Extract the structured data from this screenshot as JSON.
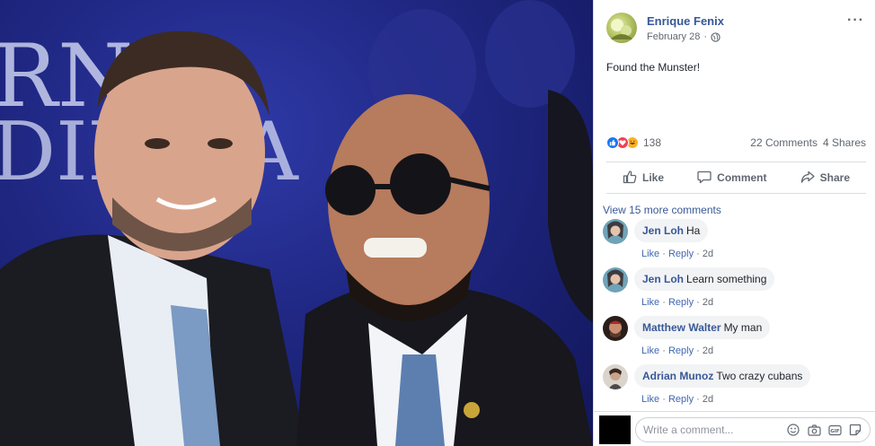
{
  "post": {
    "author": "Enrique Fenix",
    "date": "February 28",
    "caption": "Found the Munster!",
    "more_label": "···"
  },
  "photo": {
    "banner_text": [
      "RNIG",
      "DIN  SA"
    ]
  },
  "stats": {
    "reaction_count": "138",
    "comments": "22 Comments",
    "shares": "4 Shares",
    "reaction_icons": [
      "like-icon",
      "love-icon",
      "haha-icon"
    ]
  },
  "actions": {
    "like": "Like",
    "comment": "Comment",
    "share": "Share"
  },
  "view_more": "View 15 more comments",
  "comments": [
    {
      "name": "Jen Loh",
      "text": "Ha",
      "like": "Like",
      "reply": "Reply",
      "time": "2d"
    },
    {
      "name": "Jen Loh",
      "text": "Learn something",
      "like": "Like",
      "reply": "Reply",
      "time": "2d"
    },
    {
      "name": "Matthew Walter",
      "text": "My man",
      "like": "Like",
      "reply": "Reply",
      "time": "2d"
    },
    {
      "name": "Adrian Munoz",
      "text": "Two crazy cubans",
      "like": "Like",
      "reply": "Reply",
      "time": "2d"
    }
  ],
  "composer": {
    "placeholder": "Write a comment..."
  },
  "colors": {
    "link": "#385898",
    "author": "#365899",
    "muted": "#606770",
    "bubble": "#f2f3f5",
    "photo_bg": "#1f2782"
  }
}
